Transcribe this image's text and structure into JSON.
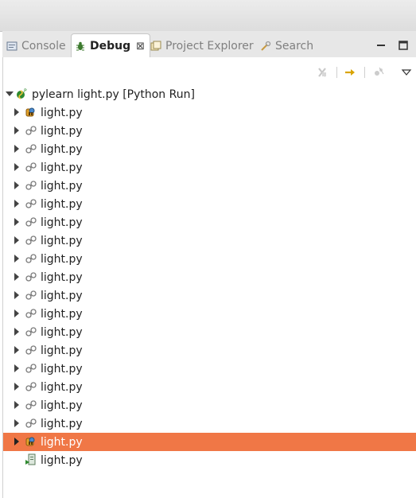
{
  "tabs": [
    {
      "label": "Console",
      "icon": "console-icon",
      "active": false
    },
    {
      "label": "Debug",
      "icon": "debug-icon",
      "active": true,
      "close_glyph": "⊠"
    },
    {
      "label": "Project Explorer",
      "icon": "project-explorer-icon",
      "active": false
    },
    {
      "label": "Search",
      "icon": "search-icon",
      "active": false
    }
  ],
  "window_controls": [
    "minimize-icon",
    "maximize-icon"
  ],
  "toolbar": [
    "remove-terminated-icon",
    "step-over-icon",
    "disconnect-icon",
    "view-menu-icon"
  ],
  "colors": {
    "selection": "#f07746",
    "thread_icon": "#7a7a7a",
    "accent_arrow": "#d9a400"
  },
  "tree": {
    "launch": {
      "label": "pylearn light.py [Python Run]",
      "expanded": true,
      "icon": "python-launch-icon"
    },
    "children": [
      {
        "label": "light.py",
        "icon": "suspended-thread-icon",
        "selected": false,
        "expandable": true
      },
      {
        "label": "light.py",
        "icon": "running-thread-icon",
        "selected": false,
        "expandable": true
      },
      {
        "label": "light.py",
        "icon": "running-thread-icon",
        "selected": false,
        "expandable": true
      },
      {
        "label": "light.py",
        "icon": "running-thread-icon",
        "selected": false,
        "expandable": true
      },
      {
        "label": "light.py",
        "icon": "running-thread-icon",
        "selected": false,
        "expandable": true
      },
      {
        "label": "light.py",
        "icon": "running-thread-icon",
        "selected": false,
        "expandable": true
      },
      {
        "label": "light.py",
        "icon": "running-thread-icon",
        "selected": false,
        "expandable": true
      },
      {
        "label": "light.py",
        "icon": "running-thread-icon",
        "selected": false,
        "expandable": true
      },
      {
        "label": "light.py",
        "icon": "running-thread-icon",
        "selected": false,
        "expandable": true
      },
      {
        "label": "light.py",
        "icon": "running-thread-icon",
        "selected": false,
        "expandable": true
      },
      {
        "label": "light.py",
        "icon": "running-thread-icon",
        "selected": false,
        "expandable": true
      },
      {
        "label": "light.py",
        "icon": "running-thread-icon",
        "selected": false,
        "expandable": true
      },
      {
        "label": "light.py",
        "icon": "running-thread-icon",
        "selected": false,
        "expandable": true
      },
      {
        "label": "light.py",
        "icon": "running-thread-icon",
        "selected": false,
        "expandable": true
      },
      {
        "label": "light.py",
        "icon": "running-thread-icon",
        "selected": false,
        "expandable": true
      },
      {
        "label": "light.py",
        "icon": "running-thread-icon",
        "selected": false,
        "expandable": true
      },
      {
        "label": "light.py",
        "icon": "running-thread-icon",
        "selected": false,
        "expandable": true
      },
      {
        "label": "light.py",
        "icon": "running-thread-icon",
        "selected": false,
        "expandable": true
      },
      {
        "label": "light.py",
        "icon": "suspended-thread-icon",
        "selected": true,
        "expandable": true
      },
      {
        "label": "light.py",
        "icon": "process-icon",
        "selected": false,
        "expandable": false
      }
    ]
  }
}
